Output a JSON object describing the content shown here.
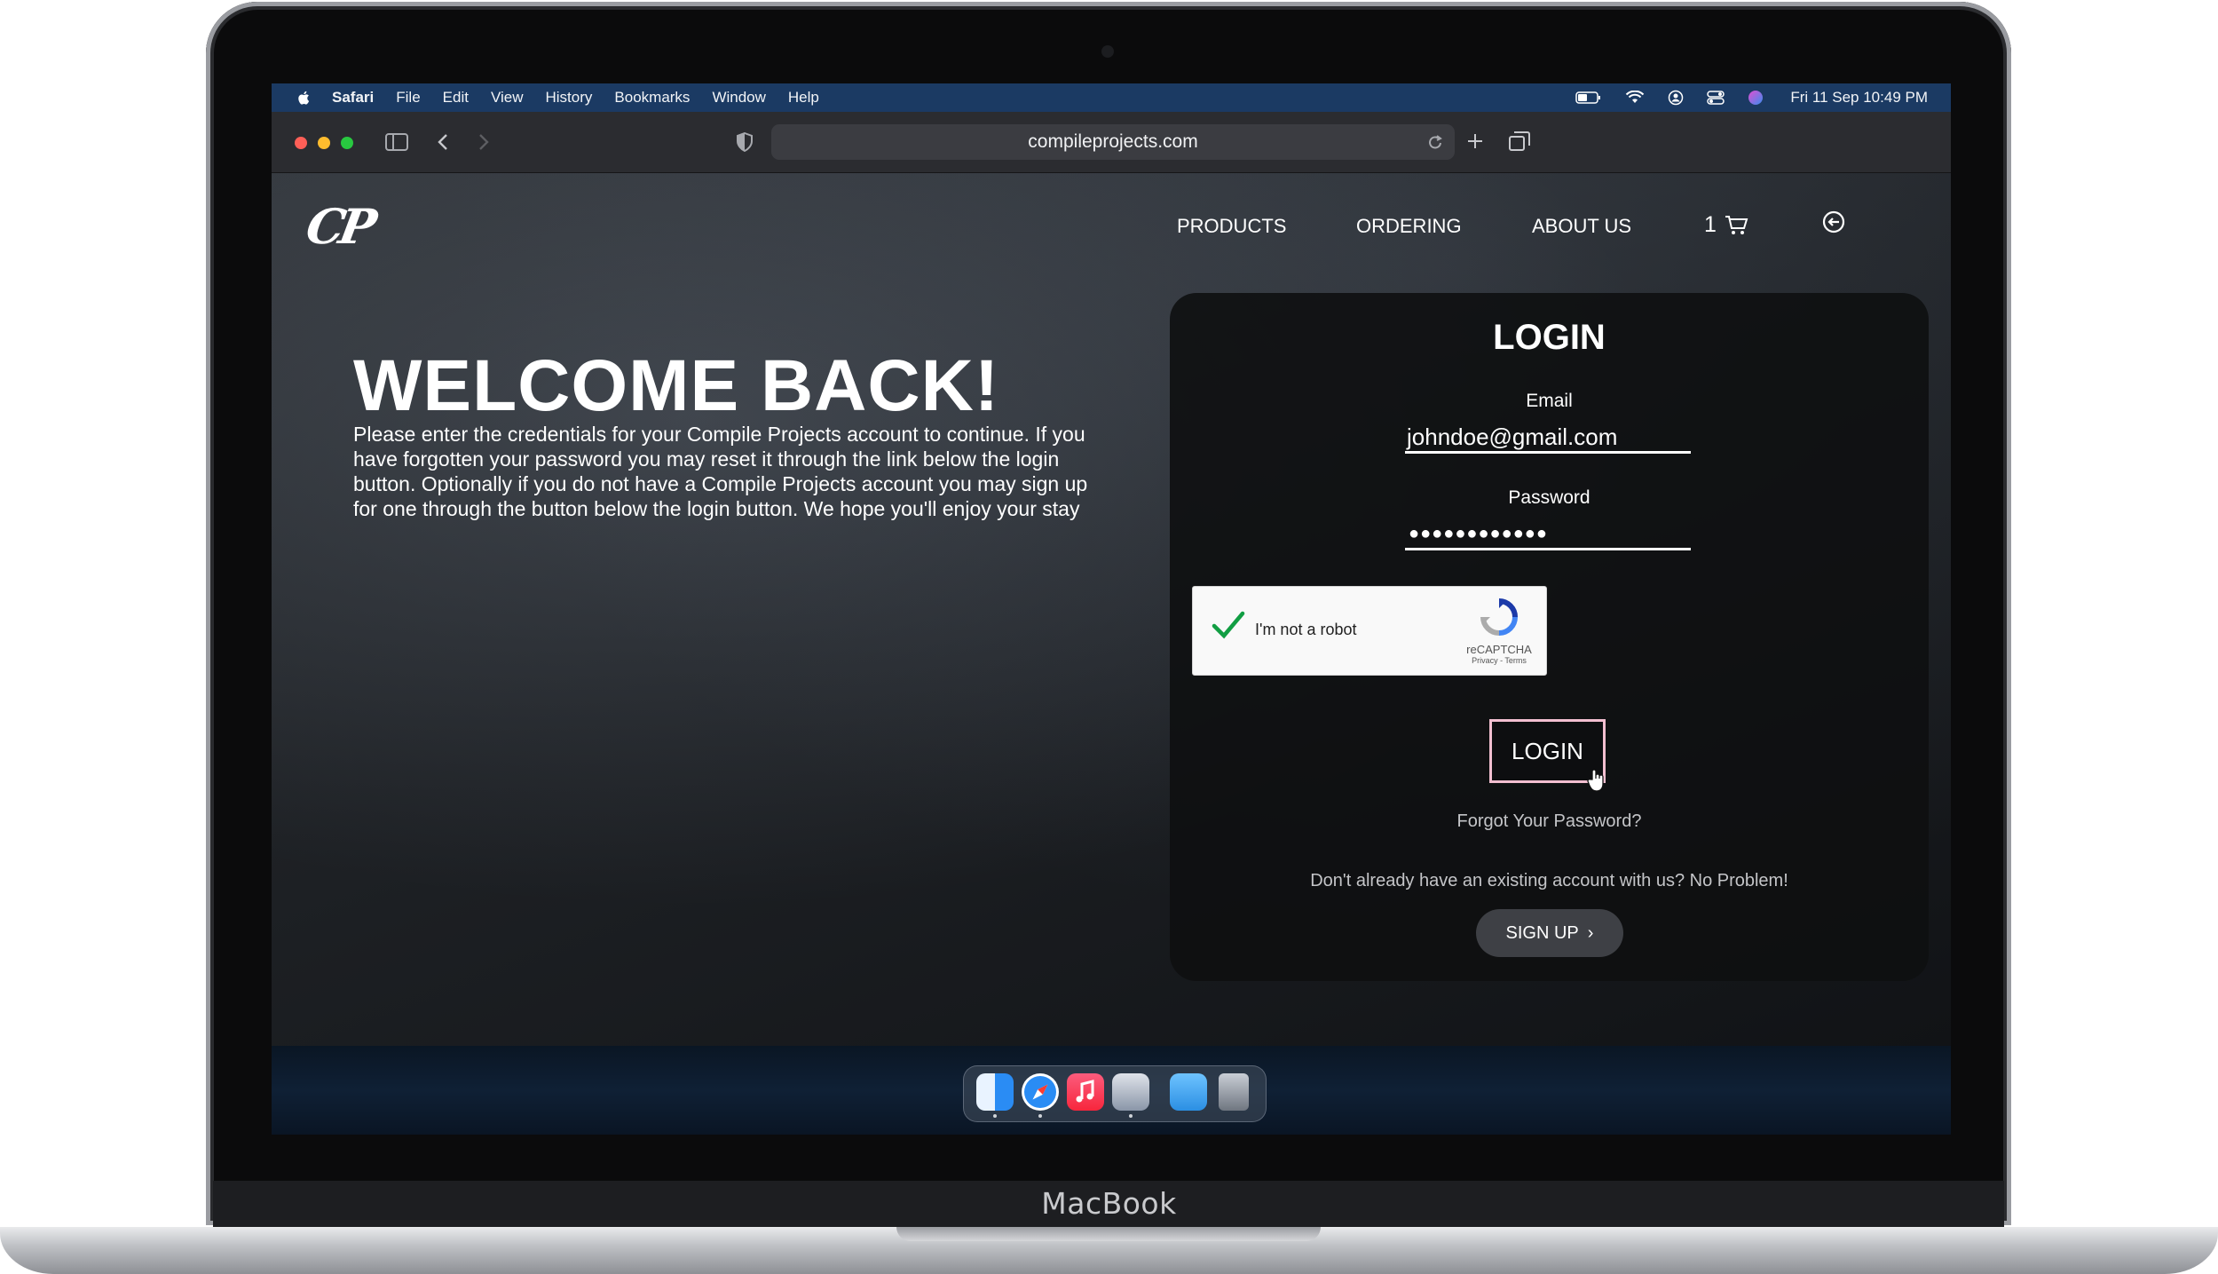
{
  "device": {
    "brand_label": "MacBook"
  },
  "menubar": {
    "app_name": "Safari",
    "items": [
      "File",
      "Edit",
      "View",
      "History",
      "Bookmarks",
      "Window",
      "Help"
    ],
    "clock": "Fri 11 Sep  10:49 PM",
    "status_icons": [
      "battery-icon",
      "wifi-icon",
      "user-icon",
      "control-center-icon",
      "siri-icon"
    ]
  },
  "browser": {
    "url": "compileprojects.com",
    "traffic_light_colors": {
      "close": "#fe5f57",
      "minimize": "#febc2e",
      "zoom": "#28c840"
    }
  },
  "site": {
    "logo_text": "CP",
    "nav": {
      "products": "PRODUCTS",
      "ordering": "ORDERING",
      "about": "ABOUT US"
    },
    "cart_count": "1"
  },
  "welcome": {
    "title": "WELCOME BACK!",
    "body": "Please enter the credentials for your Compile Projects account to continue. If you have forgotten your password you may reset it through the link below the login button. Optionally if you do not have a Compile Projects account you may sign up for one through the button below the login button. We hope you'll enjoy your stay"
  },
  "login": {
    "title": "LOGIN",
    "email_label": "Email",
    "email_value": "johndoe@gmail.com",
    "password_label": "Password",
    "password_mask": "●●●●●●●●●●●●",
    "captcha_label": "I'm not a robot",
    "captcha_brand": "reCAPTCHA",
    "captcha_links": "Privacy - Terms",
    "captcha_checked": true,
    "button": "LOGIN",
    "forgot": "Forgot Your Password?",
    "no_account": "Don't already have an existing account with us? No Problem!",
    "signup": "SIGN UP",
    "accent_color": "#f2bfd0"
  },
  "dock": {
    "apps": [
      "finder-icon",
      "safari-icon",
      "music-icon",
      "preview-icon",
      "downloads-folder-icon",
      "trash-icon"
    ]
  }
}
